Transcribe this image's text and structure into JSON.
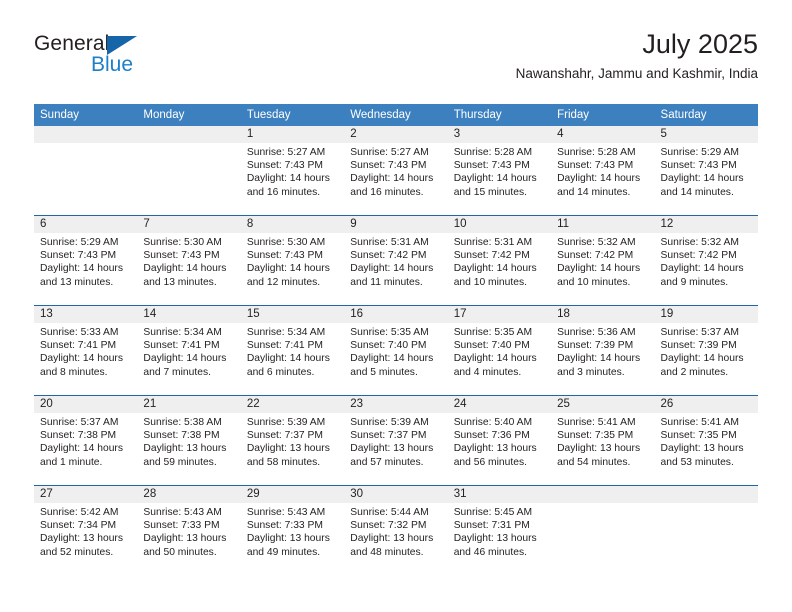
{
  "brand": {
    "name_top": "General",
    "name_bottom": "Blue",
    "logo_icon": "blue-triangle-icon",
    "colors": {
      "general": "#231f20",
      "blue": "#1d7fc9",
      "triangle": "#1565a8"
    }
  },
  "header": {
    "title": "July 2025",
    "subtitle": "Nawanshahr, Jammu and Kashmir, India"
  },
  "theme": {
    "header_bg": "#3d80bf",
    "header_text": "#ffffff",
    "daynum_bg": "#efefef",
    "week_rule": "#2166a8",
    "body_text": "#231f20"
  },
  "weekdays": [
    "Sunday",
    "Monday",
    "Tuesday",
    "Wednesday",
    "Thursday",
    "Friday",
    "Saturday"
  ],
  "weeks": [
    {
      "days": [
        {
          "num": "",
          "empty": true,
          "sunrise": "",
          "sunset": "",
          "daylight1": "",
          "daylight2": ""
        },
        {
          "num": "",
          "empty": true,
          "sunrise": "",
          "sunset": "",
          "daylight1": "",
          "daylight2": ""
        },
        {
          "num": "1",
          "empty": false,
          "sunrise": "Sunrise: 5:27 AM",
          "sunset": "Sunset: 7:43 PM",
          "daylight1": "Daylight: 14 hours",
          "daylight2": "and 16 minutes."
        },
        {
          "num": "2",
          "empty": false,
          "sunrise": "Sunrise: 5:27 AM",
          "sunset": "Sunset: 7:43 PM",
          "daylight1": "Daylight: 14 hours",
          "daylight2": "and 16 minutes."
        },
        {
          "num": "3",
          "empty": false,
          "sunrise": "Sunrise: 5:28 AM",
          "sunset": "Sunset: 7:43 PM",
          "daylight1": "Daylight: 14 hours",
          "daylight2": "and 15 minutes."
        },
        {
          "num": "4",
          "empty": false,
          "sunrise": "Sunrise: 5:28 AM",
          "sunset": "Sunset: 7:43 PM",
          "daylight1": "Daylight: 14 hours",
          "daylight2": "and 14 minutes."
        },
        {
          "num": "5",
          "empty": false,
          "sunrise": "Sunrise: 5:29 AM",
          "sunset": "Sunset: 7:43 PM",
          "daylight1": "Daylight: 14 hours",
          "daylight2": "and 14 minutes."
        }
      ]
    },
    {
      "days": [
        {
          "num": "6",
          "empty": false,
          "sunrise": "Sunrise: 5:29 AM",
          "sunset": "Sunset: 7:43 PM",
          "daylight1": "Daylight: 14 hours",
          "daylight2": "and 13 minutes."
        },
        {
          "num": "7",
          "empty": false,
          "sunrise": "Sunrise: 5:30 AM",
          "sunset": "Sunset: 7:43 PM",
          "daylight1": "Daylight: 14 hours",
          "daylight2": "and 13 minutes."
        },
        {
          "num": "8",
          "empty": false,
          "sunrise": "Sunrise: 5:30 AM",
          "sunset": "Sunset: 7:43 PM",
          "daylight1": "Daylight: 14 hours",
          "daylight2": "and 12 minutes."
        },
        {
          "num": "9",
          "empty": false,
          "sunrise": "Sunrise: 5:31 AM",
          "sunset": "Sunset: 7:42 PM",
          "daylight1": "Daylight: 14 hours",
          "daylight2": "and 11 minutes."
        },
        {
          "num": "10",
          "empty": false,
          "sunrise": "Sunrise: 5:31 AM",
          "sunset": "Sunset: 7:42 PM",
          "daylight1": "Daylight: 14 hours",
          "daylight2": "and 10 minutes."
        },
        {
          "num": "11",
          "empty": false,
          "sunrise": "Sunrise: 5:32 AM",
          "sunset": "Sunset: 7:42 PM",
          "daylight1": "Daylight: 14 hours",
          "daylight2": "and 10 minutes."
        },
        {
          "num": "12",
          "empty": false,
          "sunrise": "Sunrise: 5:32 AM",
          "sunset": "Sunset: 7:42 PM",
          "daylight1": "Daylight: 14 hours",
          "daylight2": "and 9 minutes."
        }
      ]
    },
    {
      "days": [
        {
          "num": "13",
          "empty": false,
          "sunrise": "Sunrise: 5:33 AM",
          "sunset": "Sunset: 7:41 PM",
          "daylight1": "Daylight: 14 hours",
          "daylight2": "and 8 minutes."
        },
        {
          "num": "14",
          "empty": false,
          "sunrise": "Sunrise: 5:34 AM",
          "sunset": "Sunset: 7:41 PM",
          "daylight1": "Daylight: 14 hours",
          "daylight2": "and 7 minutes."
        },
        {
          "num": "15",
          "empty": false,
          "sunrise": "Sunrise: 5:34 AM",
          "sunset": "Sunset: 7:41 PM",
          "daylight1": "Daylight: 14 hours",
          "daylight2": "and 6 minutes."
        },
        {
          "num": "16",
          "empty": false,
          "sunrise": "Sunrise: 5:35 AM",
          "sunset": "Sunset: 7:40 PM",
          "daylight1": "Daylight: 14 hours",
          "daylight2": "and 5 minutes."
        },
        {
          "num": "17",
          "empty": false,
          "sunrise": "Sunrise: 5:35 AM",
          "sunset": "Sunset: 7:40 PM",
          "daylight1": "Daylight: 14 hours",
          "daylight2": "and 4 minutes."
        },
        {
          "num": "18",
          "empty": false,
          "sunrise": "Sunrise: 5:36 AM",
          "sunset": "Sunset: 7:39 PM",
          "daylight1": "Daylight: 14 hours",
          "daylight2": "and 3 minutes."
        },
        {
          "num": "19",
          "empty": false,
          "sunrise": "Sunrise: 5:37 AM",
          "sunset": "Sunset: 7:39 PM",
          "daylight1": "Daylight: 14 hours",
          "daylight2": "and 2 minutes."
        }
      ]
    },
    {
      "days": [
        {
          "num": "20",
          "empty": false,
          "sunrise": "Sunrise: 5:37 AM",
          "sunset": "Sunset: 7:38 PM",
          "daylight1": "Daylight: 14 hours",
          "daylight2": "and 1 minute."
        },
        {
          "num": "21",
          "empty": false,
          "sunrise": "Sunrise: 5:38 AM",
          "sunset": "Sunset: 7:38 PM",
          "daylight1": "Daylight: 13 hours",
          "daylight2": "and 59 minutes."
        },
        {
          "num": "22",
          "empty": false,
          "sunrise": "Sunrise: 5:39 AM",
          "sunset": "Sunset: 7:37 PM",
          "daylight1": "Daylight: 13 hours",
          "daylight2": "and 58 minutes."
        },
        {
          "num": "23",
          "empty": false,
          "sunrise": "Sunrise: 5:39 AM",
          "sunset": "Sunset: 7:37 PM",
          "daylight1": "Daylight: 13 hours",
          "daylight2": "and 57 minutes."
        },
        {
          "num": "24",
          "empty": false,
          "sunrise": "Sunrise: 5:40 AM",
          "sunset": "Sunset: 7:36 PM",
          "daylight1": "Daylight: 13 hours",
          "daylight2": "and 56 minutes."
        },
        {
          "num": "25",
          "empty": false,
          "sunrise": "Sunrise: 5:41 AM",
          "sunset": "Sunset: 7:35 PM",
          "daylight1": "Daylight: 13 hours",
          "daylight2": "and 54 minutes."
        },
        {
          "num": "26",
          "empty": false,
          "sunrise": "Sunrise: 5:41 AM",
          "sunset": "Sunset: 7:35 PM",
          "daylight1": "Daylight: 13 hours",
          "daylight2": "and 53 minutes."
        }
      ]
    },
    {
      "days": [
        {
          "num": "27",
          "empty": false,
          "sunrise": "Sunrise: 5:42 AM",
          "sunset": "Sunset: 7:34 PM",
          "daylight1": "Daylight: 13 hours",
          "daylight2": "and 52 minutes."
        },
        {
          "num": "28",
          "empty": false,
          "sunrise": "Sunrise: 5:43 AM",
          "sunset": "Sunset: 7:33 PM",
          "daylight1": "Daylight: 13 hours",
          "daylight2": "and 50 minutes."
        },
        {
          "num": "29",
          "empty": false,
          "sunrise": "Sunrise: 5:43 AM",
          "sunset": "Sunset: 7:33 PM",
          "daylight1": "Daylight: 13 hours",
          "daylight2": "and 49 minutes."
        },
        {
          "num": "30",
          "empty": false,
          "sunrise": "Sunrise: 5:44 AM",
          "sunset": "Sunset: 7:32 PM",
          "daylight1": "Daylight: 13 hours",
          "daylight2": "and 48 minutes."
        },
        {
          "num": "31",
          "empty": false,
          "sunrise": "Sunrise: 5:45 AM",
          "sunset": "Sunset: 7:31 PM",
          "daylight1": "Daylight: 13 hours",
          "daylight2": "and 46 minutes."
        },
        {
          "num": "",
          "empty": true,
          "sunrise": "",
          "sunset": "",
          "daylight1": "",
          "daylight2": ""
        },
        {
          "num": "",
          "empty": true,
          "sunrise": "",
          "sunset": "",
          "daylight1": "",
          "daylight2": ""
        }
      ]
    }
  ]
}
